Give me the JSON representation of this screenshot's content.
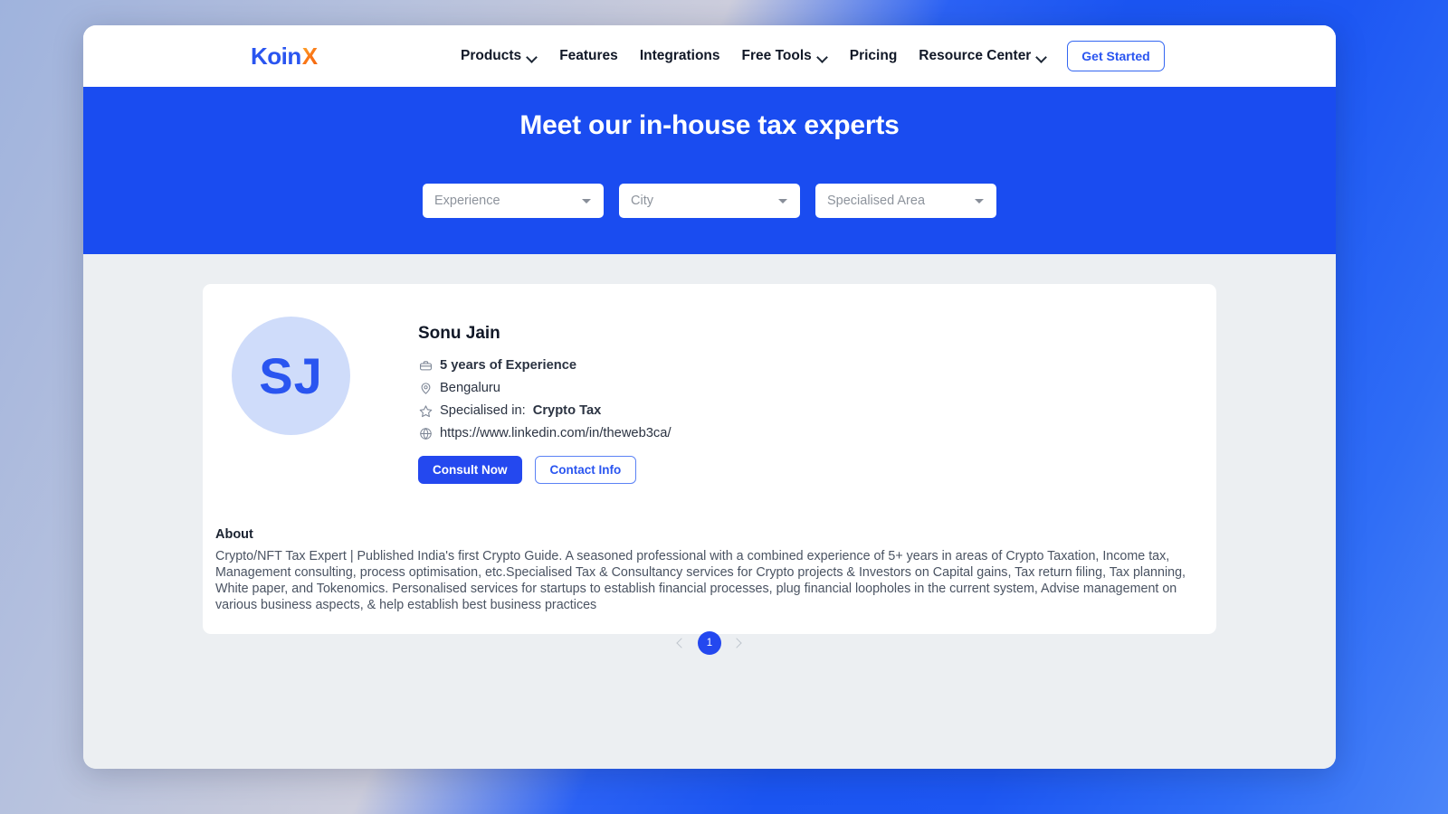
{
  "brand": {
    "name_part1": "Koin",
    "name_part2": "X",
    "primary_color": "#2448ef",
    "hero_color": "#1a4cf0",
    "accent_color": "#f97316"
  },
  "nav": {
    "items": [
      {
        "label": "Products",
        "has_dropdown": true
      },
      {
        "label": "Features",
        "has_dropdown": false
      },
      {
        "label": "Integrations",
        "has_dropdown": false
      },
      {
        "label": "Free Tools",
        "has_dropdown": true
      },
      {
        "label": "Pricing",
        "has_dropdown": false
      },
      {
        "label": "Resource Center",
        "has_dropdown": true
      }
    ],
    "cta_label": "Get Started"
  },
  "hero": {
    "title": "Meet our in-house tax experts",
    "filters": [
      {
        "placeholder": "Experience",
        "value": ""
      },
      {
        "placeholder": "City",
        "value": ""
      },
      {
        "placeholder": "Specialised Area",
        "value": ""
      }
    ]
  },
  "expert": {
    "initials": "SJ",
    "name": "Sonu Jain",
    "experience": "5 years of Experience",
    "location": "Bengaluru",
    "specialised_prefix": "Specialised in: ",
    "specialised_value": "Crypto Tax",
    "website": "https://www.linkedin.com/in/theweb3ca/",
    "buttons": {
      "consult": "Consult Now",
      "contact": "Contact Info"
    },
    "about_title": "About",
    "about_text": "Crypto/NFT Tax Expert | Published India's first Crypto Guide. A seasoned professional with a combined experience of 5+ years in areas of Crypto Taxation, Income tax, Management consulting, process optimisation, etc.Specialised Tax & Consultancy services for Crypto projects & Investors on Capital gains, Tax return filing, Tax planning, White paper, and Tokenomics. Personalised services for startups to establish financial processes, plug financial loopholes in the current system, Advise management on various business aspects, & help establish best business practices"
  },
  "pagination": {
    "current_page": "1",
    "prev_label": "",
    "next_label": ""
  }
}
